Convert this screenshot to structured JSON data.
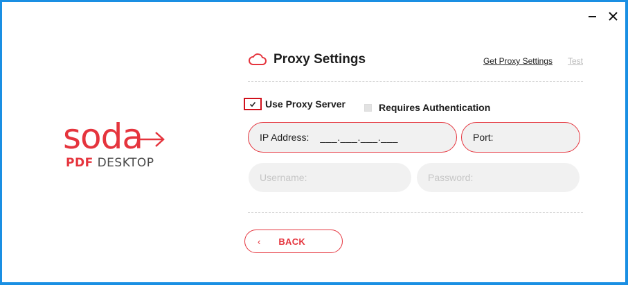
{
  "window": {
    "minimize_label": "Minimize",
    "close_label": "Close"
  },
  "logo": {
    "word": "soda",
    "sub_pdf": "PDF",
    "sub_desktop": "DESKTOP"
  },
  "header": {
    "title": "Proxy Settings",
    "get_proxy_link": "Get Proxy Settings",
    "test_link": "Test"
  },
  "options": {
    "use_proxy_label": "Use Proxy Server",
    "use_proxy_checked": true,
    "requires_auth_label": "Requires Authentication",
    "requires_auth_checked": false
  },
  "fields": {
    "ip_label": "IP Address:",
    "ip_mask": "___.___.___.___",
    "port_label": "Port:",
    "username_placeholder": "Username:",
    "password_placeholder": "Password:"
  },
  "actions": {
    "back_chevron": "‹",
    "back_label": "BACK"
  },
  "colors": {
    "accent": "#e5343d",
    "desktop_bg": "#1a8fe3",
    "field_bg": "#f1f1f1"
  }
}
